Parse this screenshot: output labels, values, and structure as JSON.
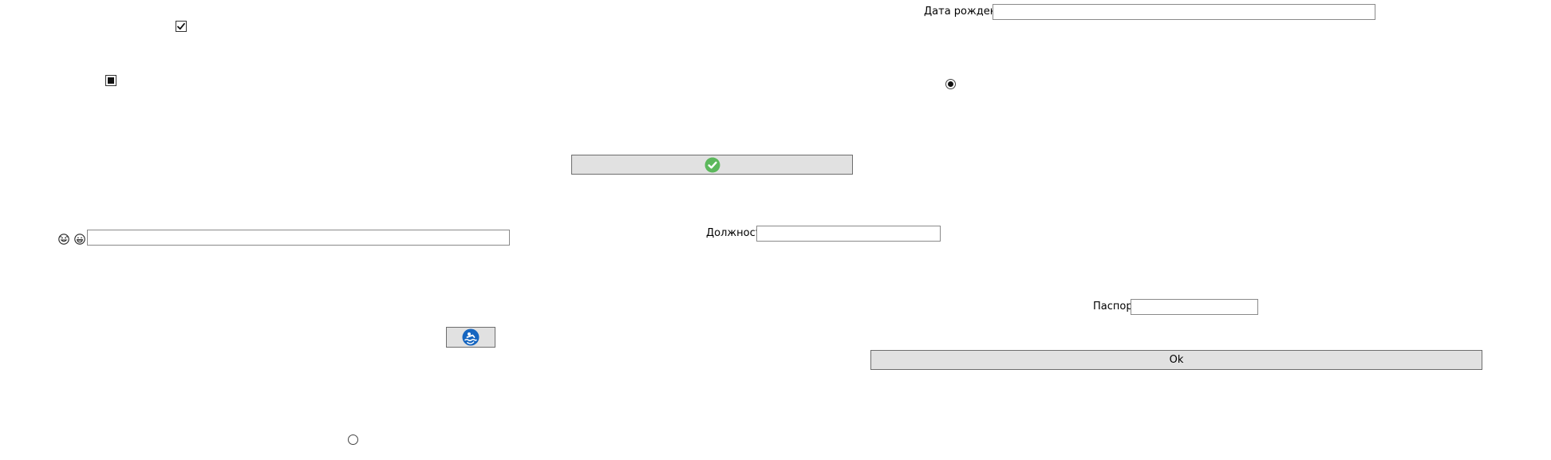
{
  "form": {
    "birth_date": {
      "label": "Дата рождения",
      "value": ""
    },
    "position": {
      "label": "Должность",
      "value": ""
    },
    "passport": {
      "label": "Паспорт",
      "value": ""
    },
    "smiley_field": {
      "value": ""
    },
    "ok_button": {
      "label": "Ok"
    }
  },
  "checkboxes": {
    "top": {
      "state": "checked"
    },
    "second": {
      "state": "indeterminate"
    }
  },
  "radios": {
    "right": {
      "selected": true
    },
    "bottom": {
      "selected": false
    }
  },
  "icons": {
    "confirm_button_icon": "check-circle-icon",
    "confirm_icon_color": "#5cb85c",
    "swim_button_icon": "swim-badge-icon",
    "swim_icon_color": "#1565c0",
    "smiley_left": "smiley-face-icon",
    "smiley_right": "grin-face-icon"
  },
  "colors": {
    "button_background": "#e1e1e1",
    "button_border": "#6d6d6d",
    "field_border": "#8a8a8a"
  }
}
